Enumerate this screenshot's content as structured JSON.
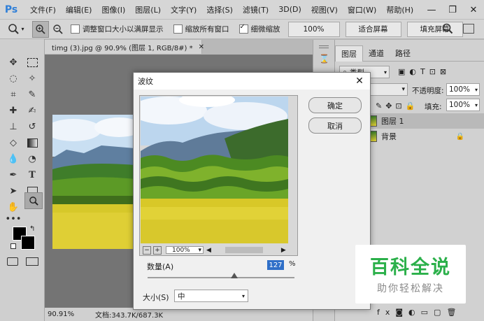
{
  "app": {
    "logo": "Ps"
  },
  "menu": [
    "文件(F)",
    "编辑(E)",
    "图像(I)",
    "图层(L)",
    "文字(Y)",
    "选择(S)",
    "滤镜(T)",
    "3D(D)",
    "视图(V)",
    "窗口(W)",
    "帮助(H)"
  ],
  "options_bar": {
    "check_resize_window": "调整窗口大小以满屏显示",
    "check_zoom_all": "缩放所有窗口",
    "check_scrubby": "细微缩放",
    "btn_100": "100%",
    "btn_fit": "适合屏幕",
    "btn_fill": "填充屏幕"
  },
  "document": {
    "tab_title": "timg (3).jpg @ 90.9% (图层 1, RGB/8#) *",
    "zoom": "90.91%",
    "doc_info": "文档:343.7K/687.3K"
  },
  "layers_panel": {
    "tabs": [
      "图层",
      "通道",
      "路径"
    ],
    "kind_filter": "类型",
    "opacity_label": "不透明度:",
    "opacity_value": "100%",
    "fill_label": "填充:",
    "fill_value": "100%",
    "layers": [
      "图层 1",
      "背景"
    ]
  },
  "dialog": {
    "title": "波纹",
    "ok": "确定",
    "cancel": "取消",
    "zoom": "100%",
    "amount_label": "数量(A)",
    "amount_value": "127",
    "amount_unit": "%",
    "amount_fraction": 0.59,
    "size_label": "大小(S)",
    "size_value": "中"
  },
  "watermark": {
    "line1": "百科全说",
    "line2": "助你轻松解决"
  }
}
